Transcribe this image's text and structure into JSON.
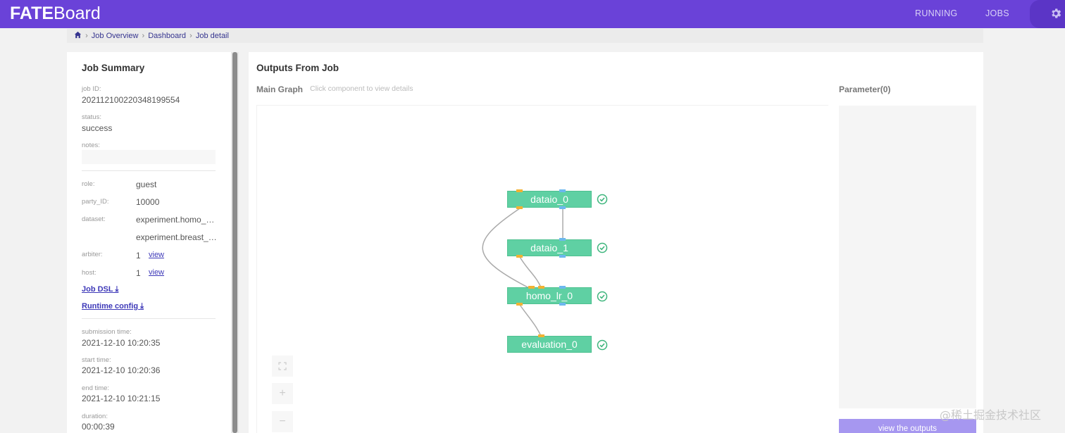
{
  "header": {
    "brand_bold": "FATE",
    "brand_light": "Board",
    "nav": [
      "RUNNING",
      "JOBS"
    ],
    "settings_icon": "gear-icon",
    "color": "#6a42d8"
  },
  "breadcrumb": {
    "home_icon": "home-icon",
    "items": [
      "Job Overview",
      "Dashboard",
      "Job detail"
    ]
  },
  "summary": {
    "title": "Job Summary",
    "job_id_label": "job ID:",
    "job_id": "202112100220348199554",
    "status_label": "status:",
    "status": "success",
    "notes_label": "notes:",
    "role_label": "role:",
    "role": "guest",
    "party_label": "party_ID:",
    "party": "10000",
    "dataset_label": "dataset:",
    "datasets": [
      "experiment.homo_breast_homo_guest",
      "experiment.breast_homo_guest"
    ],
    "arbiter_label": "arbiter:",
    "arbiter_count": "1",
    "host_label": "host:",
    "host_count": "1",
    "view_link": "view",
    "job_dsl": "Job DSL",
    "runtime_config": "Runtime config",
    "download_icon": "download-icon",
    "submission_label": "submission time:",
    "submission_time": "2021-12-10 10:20:35",
    "start_label": "start time:",
    "start_time": "2021-12-10 10:20:36",
    "end_label": "end time:",
    "end_time": "2021-12-10 10:21:15",
    "duration_label": "duration:",
    "duration": "00:00:39"
  },
  "outputs": {
    "title": "Outputs From Job",
    "main_graph": "Main Graph",
    "hint": "Click component to view details",
    "parameter_title": "Parameter(0)",
    "view_button": "view the outputs",
    "fullscreen_icon": "fullscreen-icon",
    "zoom_in": "+",
    "zoom_out": "−"
  },
  "graph": {
    "nodes": [
      "dataio_0",
      "dataio_1",
      "homo_lr_0",
      "evaluation_0"
    ],
    "node_color": "#5fd0a3",
    "status_icon": "check-circle-icon",
    "success_color": "#3db57c"
  },
  "watermark": "@稀土掘金技术社区"
}
